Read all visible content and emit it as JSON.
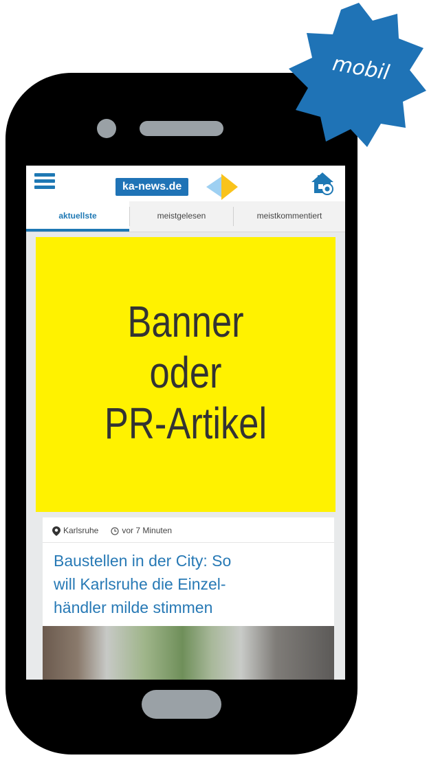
{
  "badge": {
    "label": "mobil",
    "color": "#1f73b6"
  },
  "app": {
    "logo_text": "ka-news.de",
    "icons": {
      "menu": "hamburger-icon",
      "home": "home-camera-icon"
    }
  },
  "tabs": [
    {
      "label": "aktuellste",
      "active": true
    },
    {
      "label": "meistgelesen",
      "active": false
    },
    {
      "label": "meistkommentiert",
      "active": false
    }
  ],
  "banner": {
    "text": "Banner\noder\nPR-Artikel",
    "color": "#fff200"
  },
  "article": {
    "location": "Karlsruhe",
    "time": "vor 7 Minuten",
    "headline": "Baustellen in der City: So\nwill Karlsruhe die Einzel-\nhändler milde stimmen"
  },
  "colors": {
    "accent": "#1e78b4",
    "phone": "#000000",
    "phone_buttons": "#9aa1a6"
  }
}
